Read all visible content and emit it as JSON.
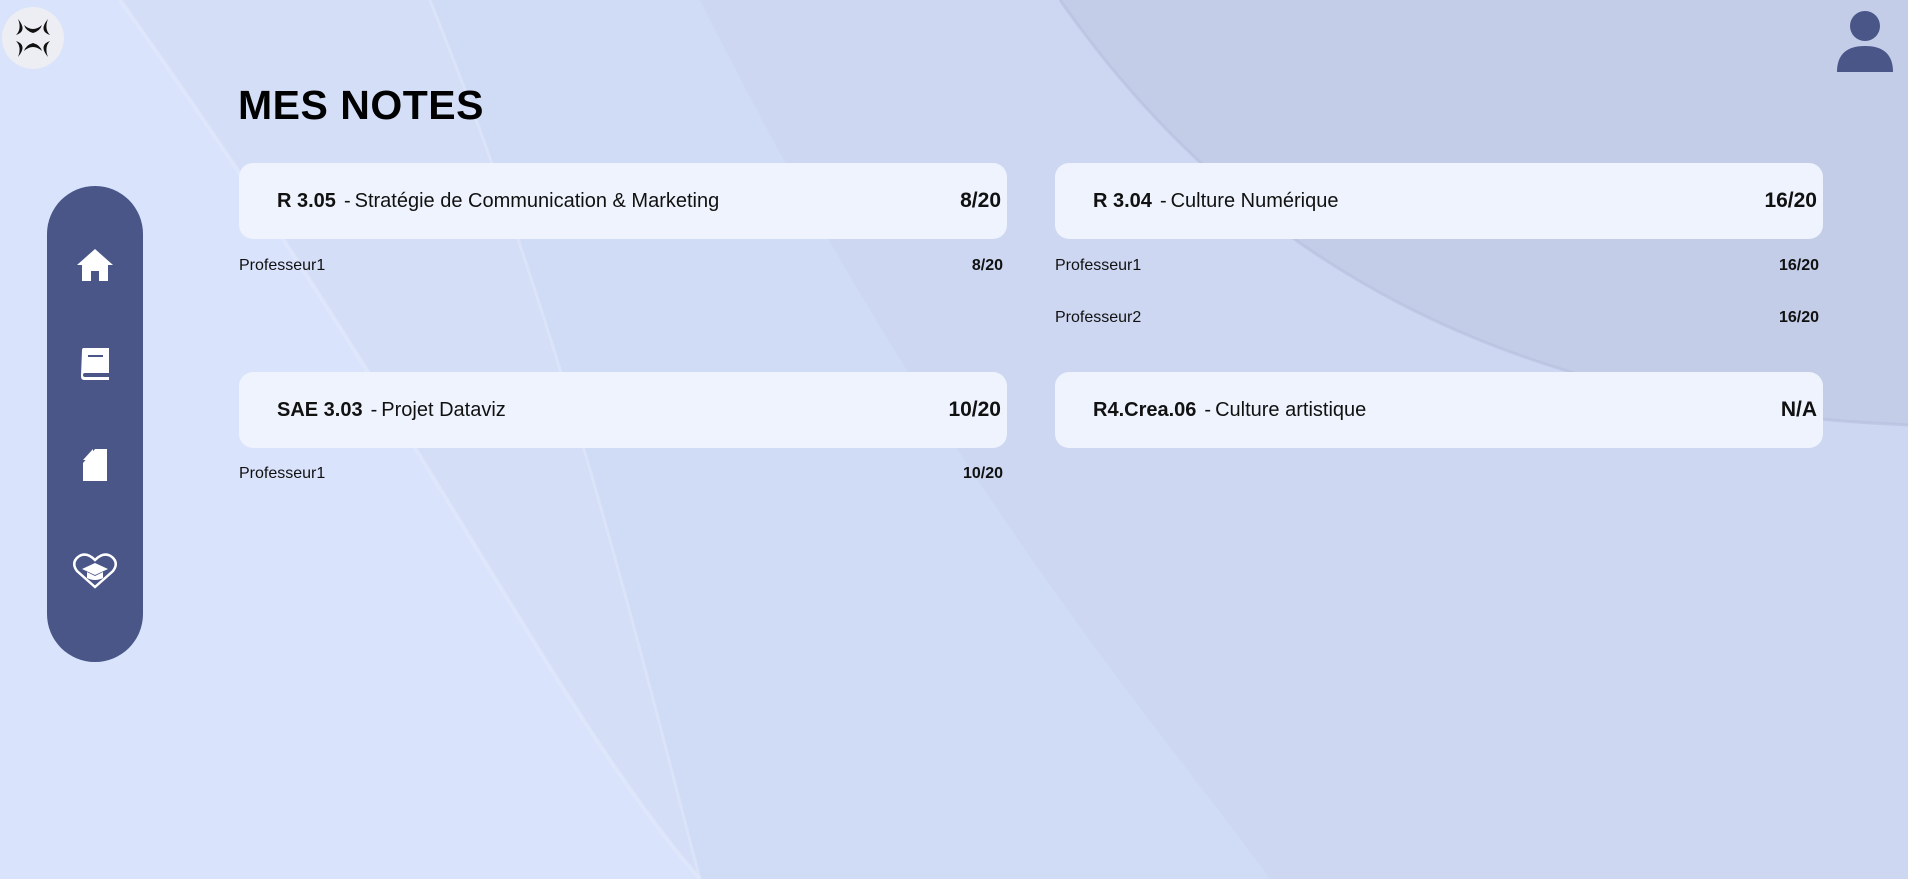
{
  "page": {
    "title": "MES NOTES"
  },
  "colors": {
    "background": "#d9e3fb",
    "sidebar": "#4a5588",
    "card": "#eef3fd",
    "text": "#111111"
  },
  "header": {
    "logo_icon": "anger-symbol-logo-icon",
    "profile_icon": "user-avatar-icon"
  },
  "sidebar": {
    "items": [
      {
        "icon": "home-icon"
      },
      {
        "icon": "book-icon"
      },
      {
        "icon": "document-icon"
      },
      {
        "icon": "graduation-cap-heart-icon"
      }
    ]
  },
  "grades": [
    {
      "code": "R 3.05",
      "separator": "-",
      "name": "Stratégie de Communication & Marketing",
      "grade": "8/20",
      "teachers": [
        {
          "name": "Professeur1",
          "grade": "8/20"
        }
      ]
    },
    {
      "code": "R 3.04",
      "separator": "-",
      "name": "Culture Numérique",
      "grade": "16/20",
      "teachers": [
        {
          "name": "Professeur1",
          "grade": "16/20"
        },
        {
          "name": "Professeur2",
          "grade": "16/20"
        }
      ]
    },
    {
      "code": "SAE 3.03",
      "separator": "-",
      "name": "Projet Dataviz",
      "grade": "10/20",
      "teachers": [
        {
          "name": "Professeur1",
          "grade": "10/20"
        }
      ]
    },
    {
      "code": "R4.Crea.06",
      "separator": "-",
      "name": "Culture artistique",
      "grade": "N/A",
      "teachers": []
    }
  ]
}
